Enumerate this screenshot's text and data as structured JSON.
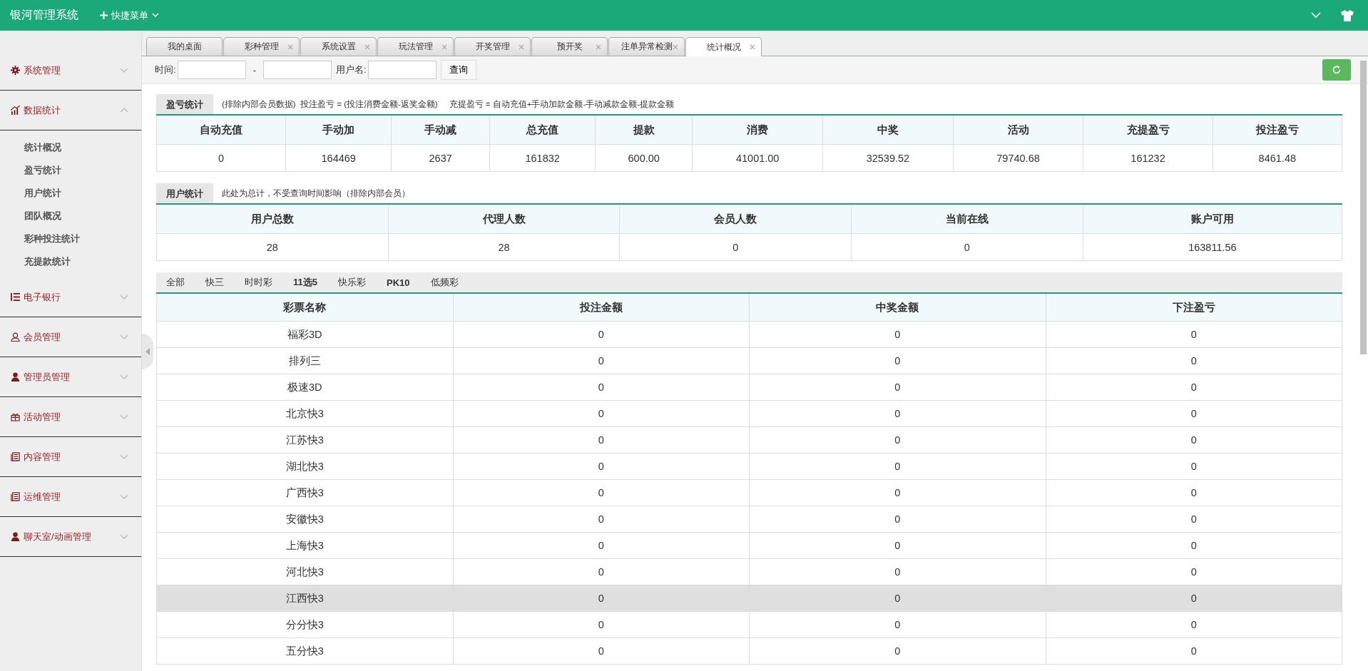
{
  "app": {
    "title": "银河管理系统",
    "quick_menu": "快捷菜单"
  },
  "sidebar": [
    {
      "label": "系统管理",
      "expanded": false
    },
    {
      "label": "数据统计",
      "expanded": true,
      "children": [
        {
          "label": "统计概况"
        },
        {
          "label": "盈亏统计"
        },
        {
          "label": "用户统计"
        },
        {
          "label": "团队概况"
        },
        {
          "label": "彩种投注统计"
        },
        {
          "label": "充提款统计"
        }
      ]
    },
    {
      "label": "电子银行",
      "expanded": false
    },
    {
      "label": "会员管理",
      "expanded": false
    },
    {
      "label": "管理员管理",
      "expanded": false
    },
    {
      "label": "活动管理",
      "expanded": false
    },
    {
      "label": "内容管理",
      "expanded": false
    },
    {
      "label": "运维管理",
      "expanded": false
    },
    {
      "label": "聊天室/动画管理",
      "expanded": false
    }
  ],
  "tabs": [
    {
      "label": "我的桌面",
      "selected": false,
      "closable": false
    },
    {
      "label": "彩种管理",
      "selected": false,
      "closable": true
    },
    {
      "label": "系统设置",
      "selected": false,
      "closable": true
    },
    {
      "label": "玩法管理",
      "selected": false,
      "closable": true
    },
    {
      "label": "开奖管理",
      "selected": false,
      "closable": true
    },
    {
      "label": "预开奖",
      "selected": false,
      "closable": true
    },
    {
      "label": "注单异常检测",
      "selected": false,
      "closable": true
    },
    {
      "label": "统计概况",
      "selected": true,
      "closable": true
    }
  ],
  "filters": {
    "time_label": "时间:",
    "separator": "-",
    "user_label": "用户名:",
    "search_button": "查询"
  },
  "profit_section": {
    "title": "盈亏统计",
    "note": "(排除内部会员数据)  投注盈亏 = (投注消费金额-返奖金额)     充提盈亏 = 自动充值+手动加款金额-手动减款金额-提款金额",
    "columns": [
      "自动充值",
      "手动加",
      "手动减",
      "总充值",
      "提款",
      "消费",
      "中奖",
      "活动",
      "充提盈亏",
      "投注盈亏"
    ],
    "values": [
      "0",
      "164469",
      "2637",
      "161832",
      "600.00",
      "41001.00",
      "32539.52",
      "79740.68",
      "161232",
      "8461.48"
    ]
  },
  "user_section": {
    "title": "用户统计",
    "note": "此处为总计，不受查询时间影响（排除内部会员）",
    "columns": [
      "用户总数",
      "代理人数",
      "会员人数",
      "当前在线",
      "账户可用"
    ],
    "values": [
      "28",
      "28",
      "0",
      "0",
      "163811.56"
    ]
  },
  "lottery": {
    "categories": [
      {
        "label": "全部",
        "bold": false
      },
      {
        "label": "快三",
        "bold": false
      },
      {
        "label": "时时彩",
        "bold": false
      },
      {
        "label": "11选5",
        "bold": true
      },
      {
        "label": "快乐彩",
        "bold": false
      },
      {
        "label": "PK10",
        "bold": true
      },
      {
        "label": "低频彩",
        "bold": false
      }
    ],
    "columns": [
      "彩票名称",
      "投注金额",
      "中奖金额",
      "下注盈亏"
    ],
    "rows": [
      {
        "cells": [
          "福彩3D",
          "0",
          "0",
          "0"
        ],
        "highlighted": false
      },
      {
        "cells": [
          "排列三",
          "0",
          "0",
          "0"
        ],
        "highlighted": false
      },
      {
        "cells": [
          "极速3D",
          "0",
          "0",
          "0"
        ],
        "highlighted": false
      },
      {
        "cells": [
          "北京快3",
          "0",
          "0",
          "0"
        ],
        "highlighted": false
      },
      {
        "cells": [
          "江苏快3",
          "0",
          "0",
          "0"
        ],
        "highlighted": false
      },
      {
        "cells": [
          "湖北快3",
          "0",
          "0",
          "0"
        ],
        "highlighted": false
      },
      {
        "cells": [
          "广西快3",
          "0",
          "0",
          "0"
        ],
        "highlighted": false
      },
      {
        "cells": [
          "安徽快3",
          "0",
          "0",
          "0"
        ],
        "highlighted": false
      },
      {
        "cells": [
          "上海快3",
          "0",
          "0",
          "0"
        ],
        "highlighted": false
      },
      {
        "cells": [
          "河北快3",
          "0",
          "0",
          "0"
        ],
        "highlighted": false
      },
      {
        "cells": [
          "江西快3",
          "0",
          "0",
          "0"
        ],
        "highlighted": true
      },
      {
        "cells": [
          "分分快3",
          "0",
          "0",
          "0"
        ],
        "highlighted": false
      },
      {
        "cells": [
          "五分快3",
          "0",
          "0",
          "0"
        ],
        "highlighted": false
      }
    ]
  }
}
